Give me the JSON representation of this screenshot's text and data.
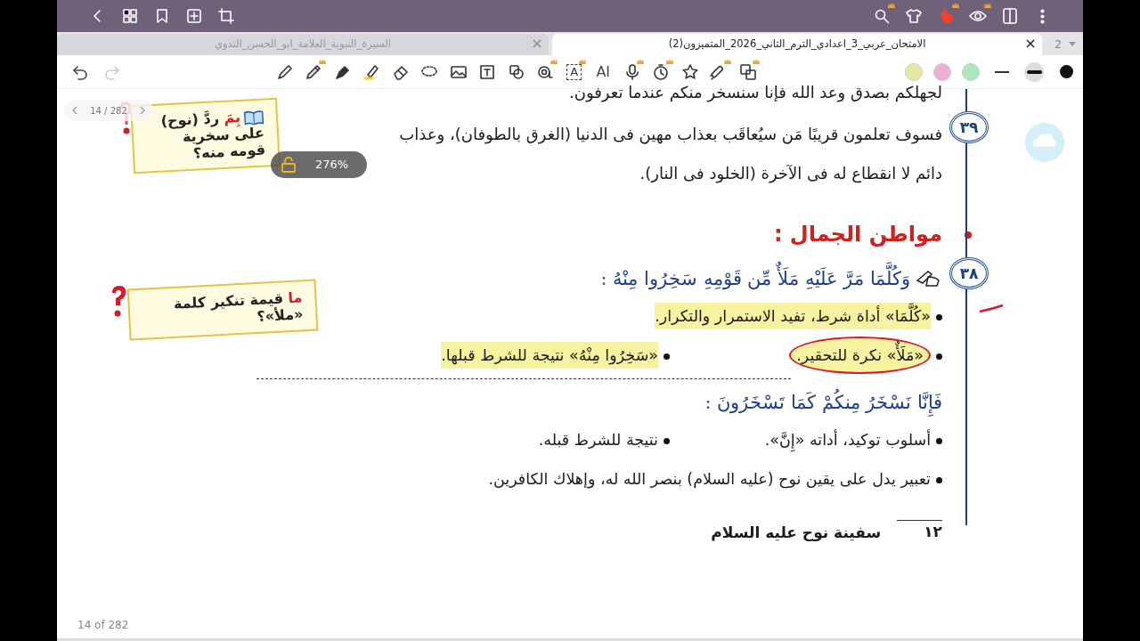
{
  "topbar": {
    "left_tools": [
      {
        "kind": "back",
        "premium": false
      },
      {
        "kind": "grid",
        "premium": false
      },
      {
        "kind": "bookmark",
        "premium": false
      },
      {
        "kind": "add",
        "premium": false
      },
      {
        "kind": "crop",
        "premium": false
      }
    ],
    "right_tools": [
      {
        "kind": "search",
        "premium": true
      },
      {
        "kind": "shirt",
        "premium": false
      },
      {
        "kind": "hand",
        "premium": true
      },
      {
        "kind": "eye",
        "premium": true
      },
      {
        "kind": "panel",
        "premium": false
      },
      {
        "kind": "more",
        "premium": false
      }
    ]
  },
  "tabs": [
    {
      "label": "الامتحان_عربي_3_اعدادي_الترم_التاني_2026_المتميزون(2)",
      "selected": true
    },
    {
      "label": "السيرة_النبوية_العلامة_ابو_الحسن_الندوي",
      "selected": false
    }
  ],
  "tab_count": "2",
  "history": [
    {
      "kind": "undo",
      "disabled": false
    },
    {
      "kind": "redo",
      "disabled": true
    }
  ],
  "tools": [
    {
      "kind": "translate",
      "premium": true
    },
    {
      "kind": "laser",
      "premium": true
    },
    {
      "kind": "sticker",
      "premium": false
    },
    {
      "kind": "timer",
      "premium": true
    },
    {
      "kind": "mic",
      "premium": true
    },
    {
      "kind": "ai",
      "label": "AI",
      "premium": false
    },
    {
      "kind": "ocr",
      "label": "A",
      "premium": true
    },
    {
      "kind": "tape",
      "premium": true
    },
    {
      "kind": "shapes",
      "premium": false
    },
    {
      "kind": "textbox",
      "premium": false
    },
    {
      "kind": "image",
      "premium": false
    },
    {
      "kind": "lasso",
      "premium": false
    },
    {
      "kind": "eraser",
      "premium": false
    },
    {
      "kind": "highlighter",
      "premium": false
    },
    {
      "kind": "fountain",
      "premium": false
    },
    {
      "kind": "pencil",
      "premium": true
    },
    {
      "kind": "pen",
      "premium": false
    }
  ],
  "swatches": [
    {
      "color": "#e6e6a6"
    },
    {
      "color": "#eeaed6"
    },
    {
      "color": "#aee6c0"
    }
  ],
  "strokes": [
    {
      "kind": "thin",
      "selected": false
    },
    {
      "kind": "thick",
      "selected": true
    },
    {
      "kind": "dot",
      "selected": false
    }
  ],
  "page_nav": {
    "label": "14 / 282"
  },
  "zoom": {
    "label": "276%"
  },
  "document": {
    "cut_line": "لجهلكم بصدق وعد الله فإنا سنسخر منكم عندما تعرفون.",
    "blocks": [
      {
        "kind": "note",
        "number": "٣٩",
        "text": "فسوف تعلمون قريبًا مَن سيُعاقَب بعذاب مهين فى الدنيا (الغرق بالطوفان)، وعذاب دائم لا انقطاع له فى الآخرة (الخلود فى النار)."
      },
      {
        "kind": "heading",
        "text": "مواطن الجمال :"
      },
      {
        "kind": "verse",
        "number": "٣٨",
        "text": "وَكُلَّمَا مَرَّ عَلَيْهِ مَلَأٌ مِّن قَوْمِهِ سَخِرُوا مِنْهُ :"
      },
      {
        "kind": "bullets",
        "items": [
          {
            "text": "«كُلَّمَا» أداة شرط، تفيد الاستمرار والتكرار.",
            "highlighted": true,
            "circled": false,
            "ticked": true
          }
        ]
      },
      {
        "kind": "bullets",
        "items": [
          {
            "text": "«مَلَأٌ» نكرة للتحقير.",
            "highlighted": true,
            "circled": true,
            "ticked": false
          },
          {
            "text": "«سَخِرُوا مِنْهُ» نتيجة للشرط قبلها.",
            "highlighted": true,
            "circled": false,
            "ticked": false
          }
        ]
      },
      {
        "kind": "rule"
      },
      {
        "kind": "verse",
        "text": "فَإِنَّا نَسْخَرُ مِنكُمْ كَمَا تَسْخَرُونَ :"
      },
      {
        "kind": "bullets",
        "items": [
          {
            "text": "أسلوب توكيد، أداته «إِنَّ».",
            "highlighted": false,
            "circled": false,
            "ticked": false
          },
          {
            "text": "نتيجة للشرط قبله.",
            "highlighted": false,
            "circled": false,
            "ticked": false
          }
        ]
      },
      {
        "kind": "bullets",
        "items": [
          {
            "text": "تعبير يدل على يقين نوح (عليه السلام) بنصر الله له، وإهلاك الكافرين.",
            "highlighted": false,
            "circled": false,
            "ticked": false
          }
        ]
      }
    ],
    "footer": {
      "page_number": "١٢",
      "title": "سفينة نوح عليه السلام"
    }
  },
  "side_notes": [
    {
      "kind": "book",
      "lead": "بِمَ",
      "text": "ردَّ (نوح) على سخرية قومه منه؟"
    },
    {
      "kind": "question",
      "lead": "ما",
      "text": "قيمة تنكير كلمة «ملأ»؟"
    }
  ],
  "page_indicator": "14 of 282"
}
